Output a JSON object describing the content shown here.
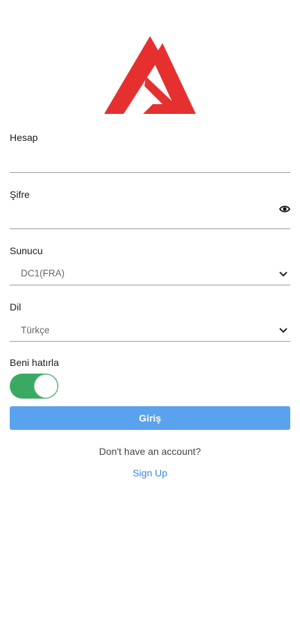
{
  "logo": {
    "name": "logo",
    "colors": {
      "primary": "#e63030"
    }
  },
  "account": {
    "label": "Hesap",
    "value": "",
    "placeholder": ""
  },
  "password": {
    "label": "Şifre",
    "value": "",
    "placeholder": "",
    "icon": "eye-icon"
  },
  "server": {
    "label": "Sunucu",
    "value": "DC1(FRA)",
    "icon": "chevron-down-icon"
  },
  "language": {
    "label": "Dil",
    "value": "Türkçe",
    "icon": "chevron-down-icon"
  },
  "remember": {
    "label": "Beni hatırla",
    "checked": true
  },
  "login_button": {
    "label": "Giriş"
  },
  "signup_prompt": {
    "text": "Don't have an account?",
    "link": "Sign Up"
  },
  "colors": {
    "toggle_on": "#3aaa63",
    "button": "#5aa2ee",
    "link": "#3b86e6",
    "logo": "#e63030"
  }
}
